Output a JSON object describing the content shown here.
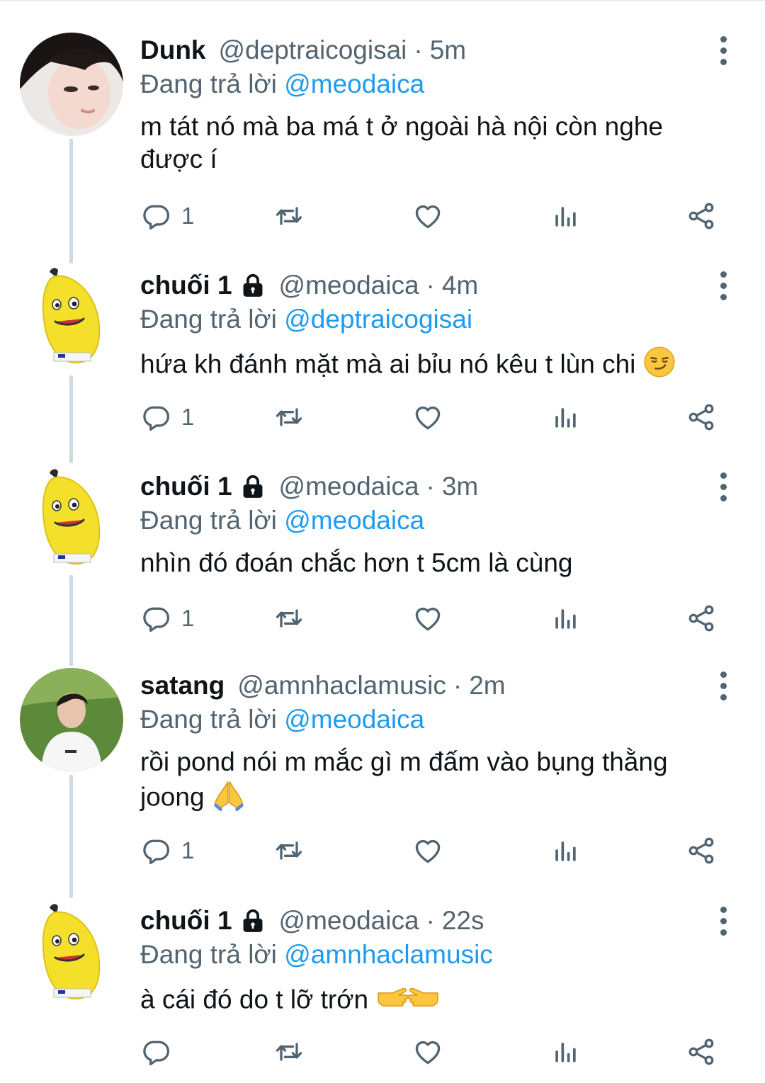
{
  "tweets": [
    {
      "name": "Dunk",
      "locked": false,
      "handle": "@deptraicogisai",
      "dot": "·",
      "time": "5m",
      "reply_prefix": "Đang trả lời",
      "reply_to": "@meodaica",
      "text": "m tát nó mà ba má t ở ngoài hà nội còn nghe được í",
      "emoji": "",
      "reply_count": "1",
      "avatar": "person-photo"
    },
    {
      "name": "chuối 1",
      "locked": true,
      "handle": "@meodaica",
      "dot": "·",
      "time": "4m",
      "reply_prefix": "Đang trả lời",
      "reply_to": "@deptraicogisai",
      "text": "hứa kh đánh mặt mà ai bỉu nó kêu t lùn chi",
      "emoji": "smirk",
      "reply_count": "1",
      "avatar": "banana"
    },
    {
      "name": "chuối 1",
      "locked": true,
      "handle": "@meodaica",
      "dot": "·",
      "time": "3m",
      "reply_prefix": "Đang trả lời",
      "reply_to": "@meodaica",
      "text": "nhìn đó đoán chắc hơn t 5cm là cùng",
      "emoji": "",
      "reply_count": "1",
      "avatar": "banana"
    },
    {
      "name": "satang",
      "locked": false,
      "handle": "@amnhaclamusic",
      "dot": "·",
      "time": "2m",
      "reply_prefix": "Đang trả lời",
      "reply_to": "@meodaica",
      "text": "rồi pond nói m mắc gì m đấm vào bụng thằng joong",
      "emoji": "folded-hands",
      "reply_count": "1",
      "avatar": "person-grass"
    },
    {
      "name": "chuối 1",
      "locked": true,
      "handle": "@meodaica",
      "dot": "·",
      "time": "22s",
      "reply_prefix": "Đang trả lời",
      "reply_to": "@amnhaclamusic",
      "text": "à cái đó do t lỡ trớn",
      "emoji": "pointing-fingers",
      "reply_count": "",
      "avatar": "banana"
    }
  ],
  "icons": {
    "reply": "reply-icon",
    "retweet": "retweet-icon",
    "like": "heart-icon",
    "views": "analytics-icon",
    "share": "share-icon",
    "more": "more-options-icon",
    "lock": "lock-icon"
  },
  "colors": {
    "text": "#0f1419",
    "secondary": "#536471",
    "mention": "#1d9bf0",
    "thread_line": "#cfd9de"
  }
}
